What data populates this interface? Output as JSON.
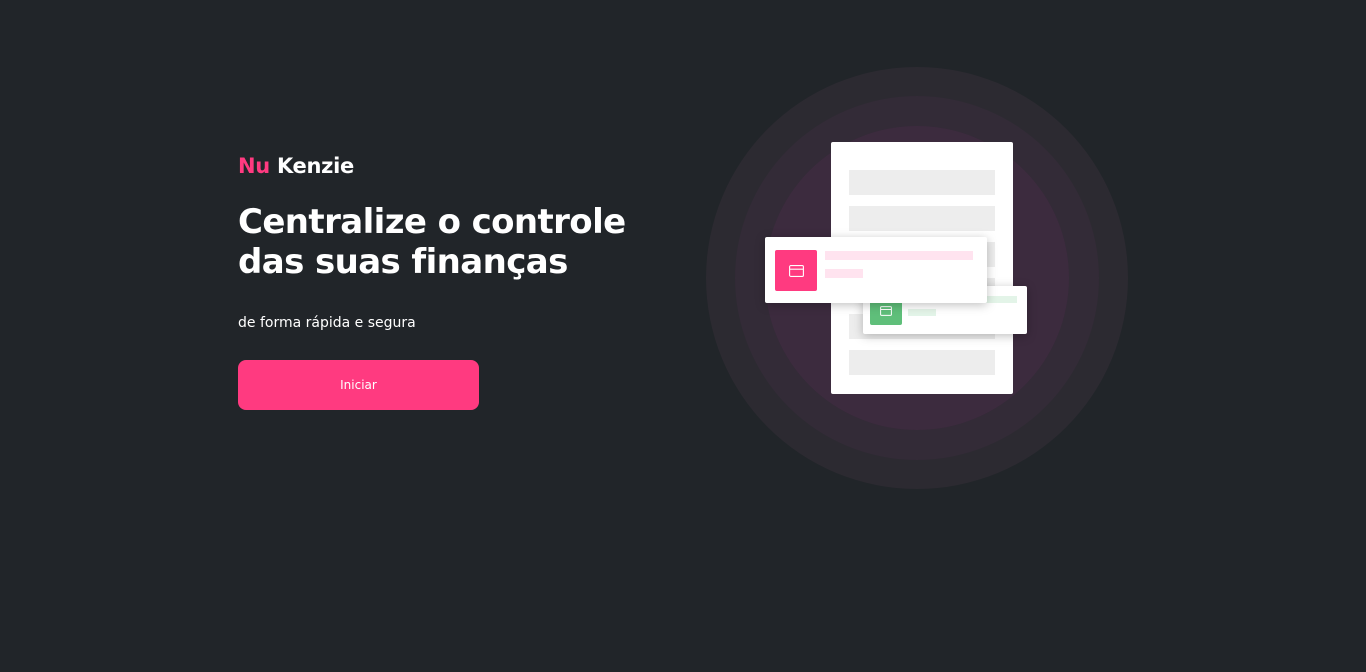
{
  "brand": {
    "name_part1": "Nu",
    "name_part2": "Kenzie"
  },
  "hero": {
    "headline": "Centralize o controle das suas finanças",
    "subtitle": "de forma rápida e segura",
    "cta_label": "Iniciar"
  },
  "illustration": {
    "icons": [
      "credit-card-icon",
      "credit-card-icon"
    ]
  },
  "colors": {
    "background": "#212529",
    "accent": "#ff3a80",
    "positive": "#5fbf7a",
    "text": "#ffffff"
  }
}
